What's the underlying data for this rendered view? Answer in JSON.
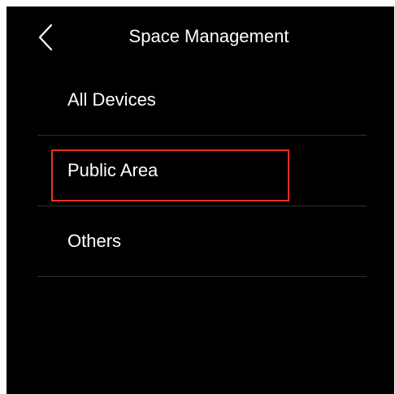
{
  "header": {
    "title": "Space Management",
    "back_icon": "chevron-left-icon"
  },
  "list": {
    "items": [
      {
        "label": "All Devices"
      },
      {
        "label": "Public Area"
      },
      {
        "label": "Others"
      }
    ]
  },
  "highlight": {
    "target": "Public Area",
    "color": "#e8321e"
  },
  "colors": {
    "background": "#000000",
    "text": "#ffffff",
    "divider": "#2e2e2e"
  }
}
